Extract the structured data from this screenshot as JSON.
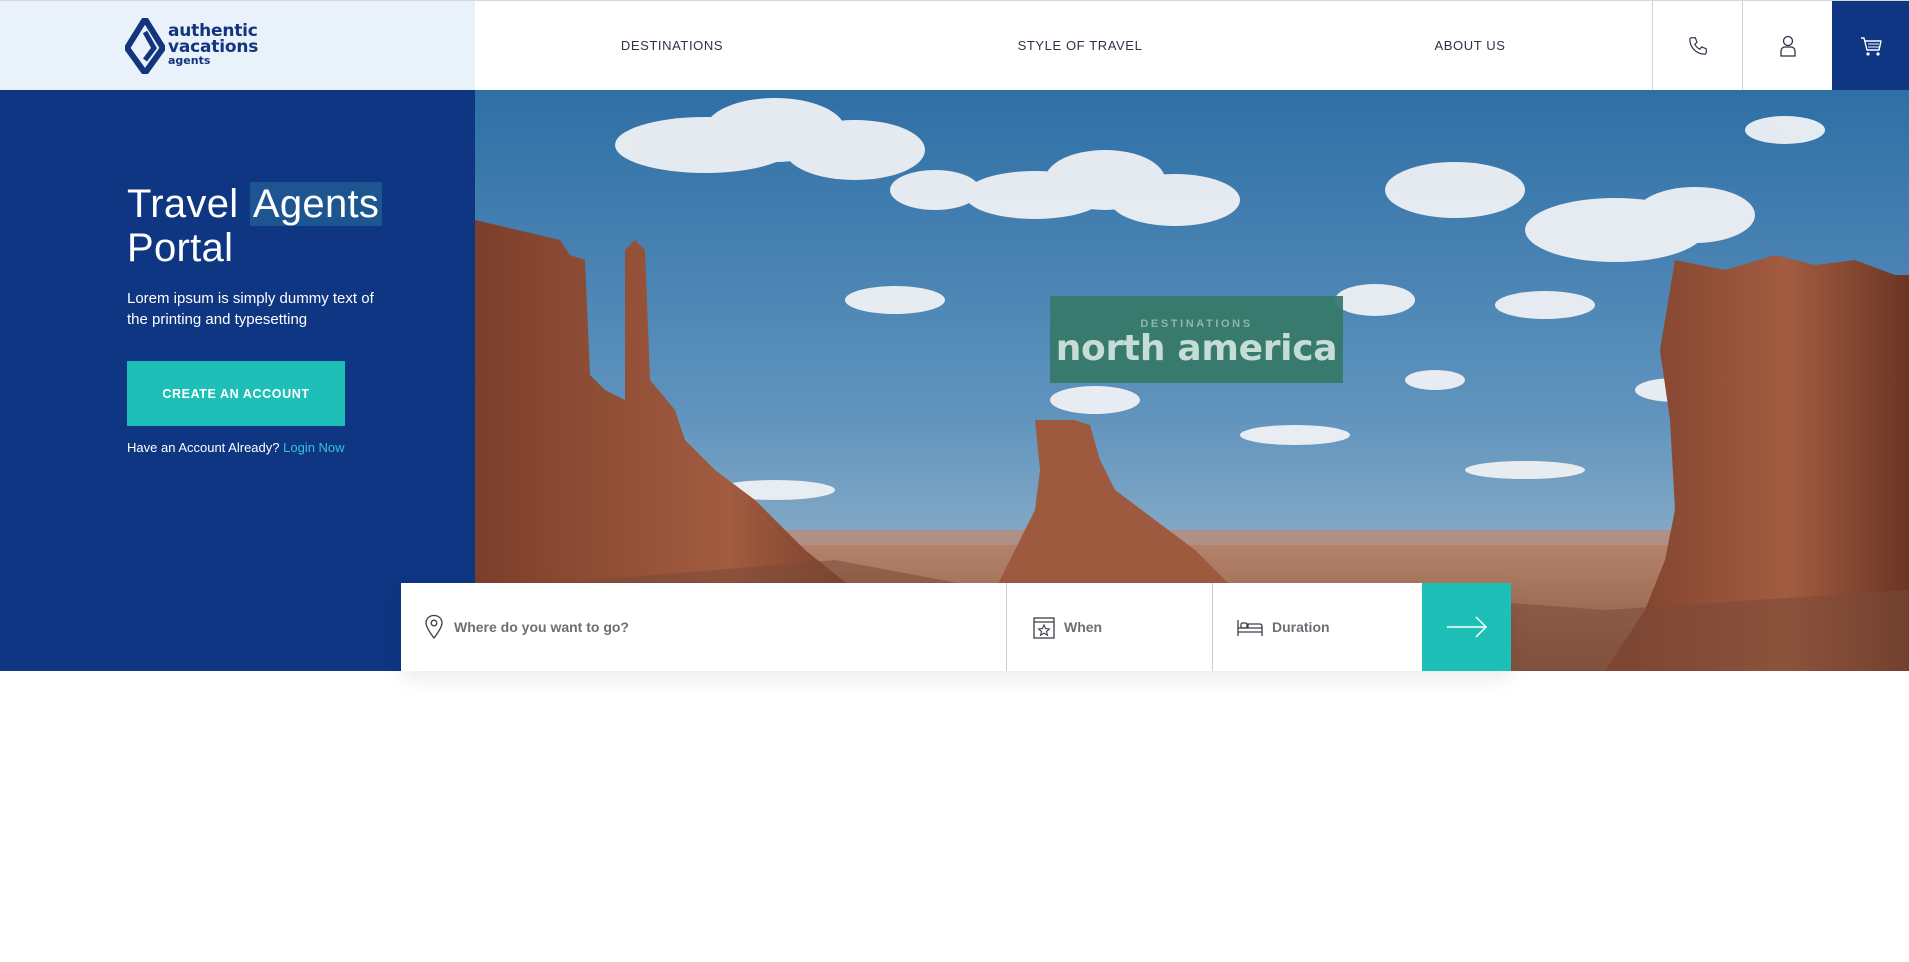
{
  "brand": {
    "line1": "authentic",
    "line2": "vacations",
    "line3": "agents"
  },
  "nav": {
    "destinations": "DESTINATIONS",
    "style_of_travel": "STYLE OF TRAVEL",
    "about_us": "ABOUT US"
  },
  "header_icons": [
    "phone-icon",
    "user-icon",
    "cart-icon"
  ],
  "hero": {
    "title_part1": "Travel",
    "title_highlight": "Agents",
    "title_part2": "Portal",
    "subtitle": "Lorem ipsum is simply dummy text of the printing and typesetting",
    "cta_label": "CREATE AN ACCOUNT",
    "login_prompt": "Have an Account Already?",
    "login_link": "Login Now"
  },
  "destination_badge": {
    "kicker": "DESTINATIONS",
    "name": "north america"
  },
  "search": {
    "where_placeholder": "Where do you want to go?",
    "when_label": "When",
    "duration_label": "Duration"
  },
  "colors": {
    "brand_navy": "#0f3682",
    "accent_teal": "#1dbfb7",
    "logo_bg": "#e9f1fb",
    "badge_green": "#367868"
  }
}
